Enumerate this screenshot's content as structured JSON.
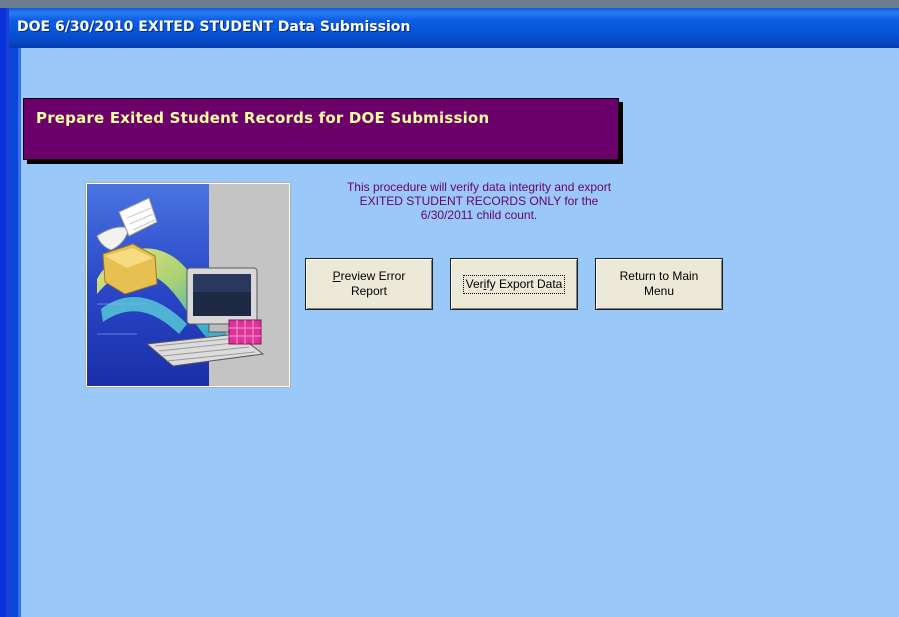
{
  "window": {
    "title": "DOE 6/30/2010 EXITED STUDENT Data Submission"
  },
  "banner": {
    "text": "Prepare Exited Student Records for DOE Submission"
  },
  "description": {
    "lines": [
      "This procedure will verify data integrity and export",
      "EXITED STUDENT RECORDS ONLY for the",
      "6/30/2011 child count."
    ]
  },
  "buttons": {
    "preview": {
      "mnemonic": "P",
      "line1_rest": "review Error",
      "line2": "Report"
    },
    "verify": {
      "pre": "Ver",
      "mnemonic": "i",
      "post": "fy Export Data"
    },
    "return": {
      "line1": "Return to Main",
      "line2": "Menu"
    }
  },
  "image": {
    "icon": "computer-data-export-illustration"
  },
  "colors": {
    "window_background": "#99c8f9",
    "banner_background": "#6b006b",
    "banner_text": "#ffffa0",
    "description_text": "#6b006b",
    "titlebar": "#0654d8",
    "button_face": "#ece9d8"
  }
}
